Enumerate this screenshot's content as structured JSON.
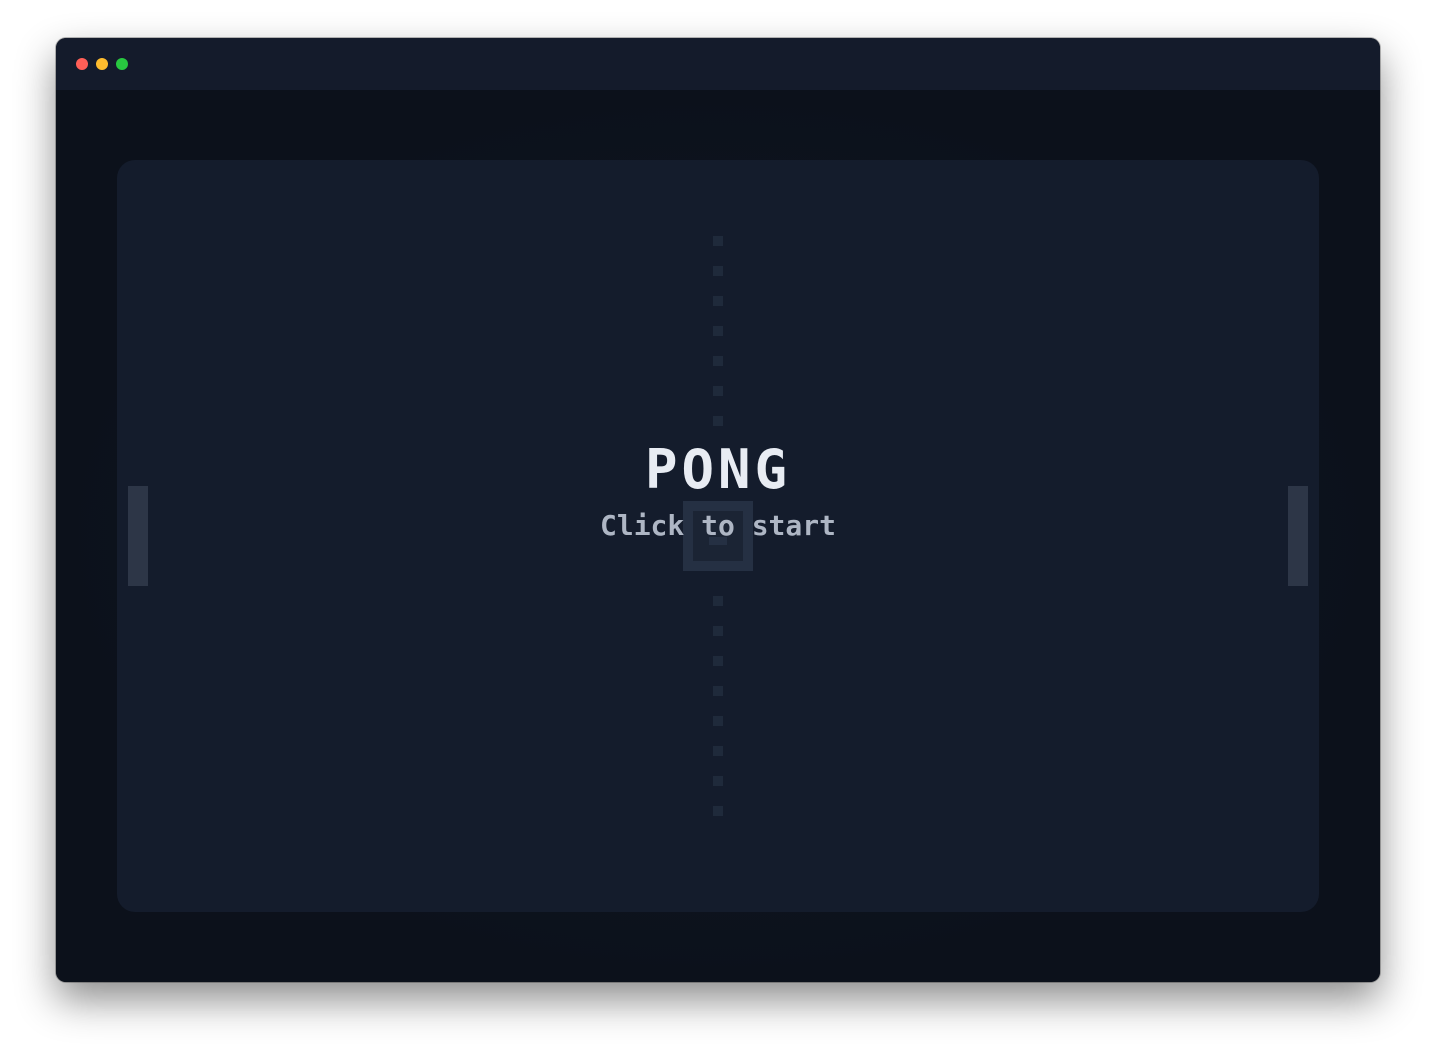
{
  "window": {
    "controls": {
      "close_color": "#ff5f57",
      "minimize_color": "#febc2e",
      "maximize_color": "#28c840"
    }
  },
  "game": {
    "title": "PONG",
    "prompt": "Click to start",
    "colors": {
      "background": "#0c111b",
      "court": "#141c2c",
      "paddle": "#2d3647",
      "net": "#1f2a3b",
      "title": "#e8ecf3",
      "prompt": "#aeb6c4"
    },
    "paddles": [
      "left-paddle",
      "right-paddle"
    ],
    "ball_icon": "square-ball"
  }
}
